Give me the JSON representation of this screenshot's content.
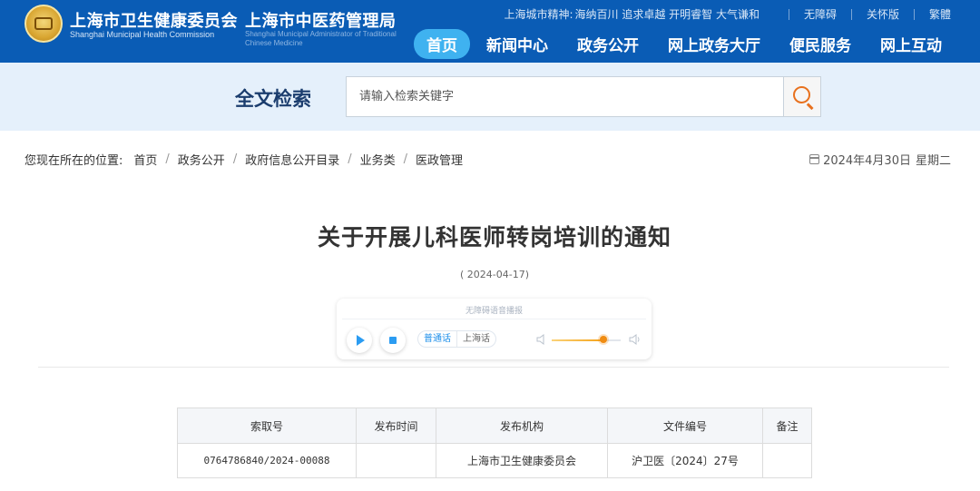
{
  "header": {
    "org1_cn": "上海市卫生健康委员会",
    "org1_en": "Shanghai Municipal Health Commission",
    "org2_cn": "上海市中医药管理局",
    "org2_en": "Shanghai Municipal Administrator of Traditional Chinese Medicine",
    "spirit_label": "上海城市精神:",
    "spirit_text": "海纳百川 追求卓越 开明睿智 大气谦和",
    "links": [
      "无障碍",
      "关怀版",
      "繁體"
    ],
    "nav": [
      "首页",
      "新闻中心",
      "政务公开",
      "网上政务大厅",
      "便民服务",
      "网上互动"
    ],
    "nav_active": "首页",
    "brand_color": "#0a5cb5",
    "active_color": "#3fb2f0"
  },
  "search": {
    "title": "全文检索",
    "placeholder": "请输入检索关键字",
    "button_icon": "search-icon"
  },
  "breadcrumb": {
    "lead": "您现在所在的位置:",
    "items": [
      "首页",
      "政务公开",
      "政府信息公开目录",
      "业务类",
      "医政管理"
    ]
  },
  "date_display": {
    "date": "2024年4月30日",
    "weekday": "星期二",
    "icon": "calendar-icon"
  },
  "article": {
    "title": "关于开展儿科医师转岗培训的通知",
    "published": "( 2024-04-17)"
  },
  "player": {
    "label": "无障碍语音播报",
    "play_icon": "play-icon",
    "stop_icon": "stop-icon",
    "lang_options": [
      "普通话",
      "上海话"
    ],
    "lang_selected": "普通话",
    "volume": 0.75
  },
  "info_table": {
    "headers": [
      "索取号",
      "发布时间",
      "发布机构",
      "文件编号",
      "备注"
    ],
    "row": [
      "0764786840/2024-00088",
      "",
      "上海市卫生健康委员会",
      "沪卫医〔2024〕27号",
      ""
    ]
  }
}
